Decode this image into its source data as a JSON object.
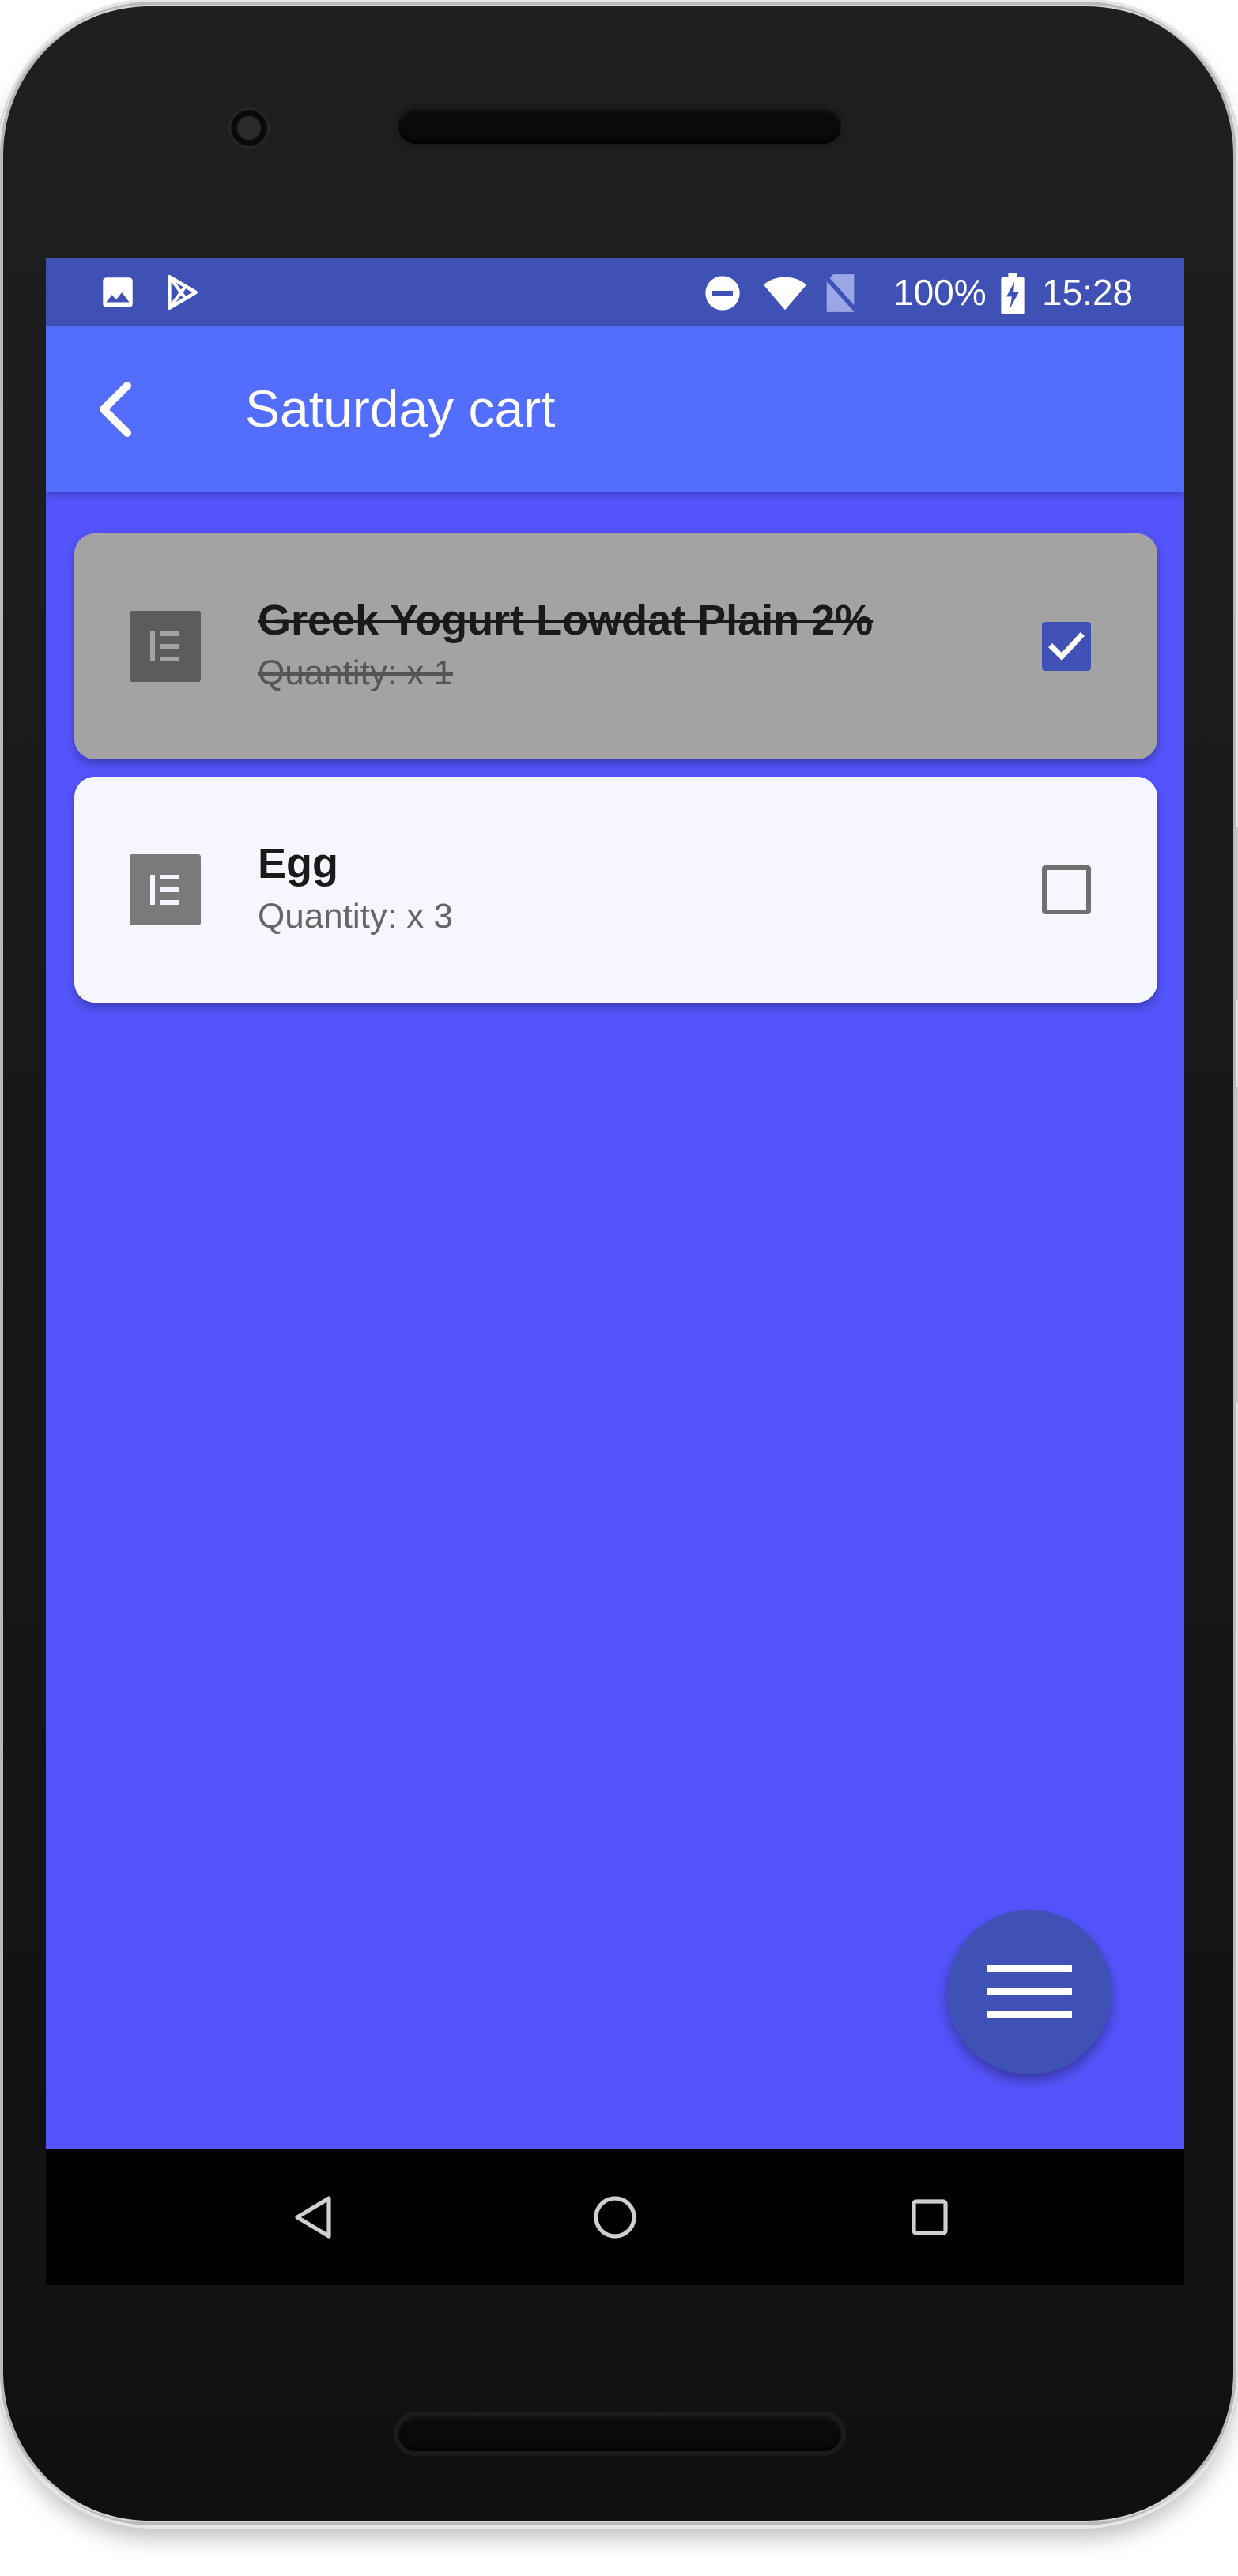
{
  "status_bar": {
    "battery": "100%",
    "time": "15:28",
    "left_icons": [
      "image-icon",
      "play-store-icon"
    ],
    "right_icons": [
      "do-not-disturb-icon",
      "wifi-icon",
      "no-sim-icon",
      "battery-charging-icon"
    ]
  },
  "app_bar": {
    "title": "Saturday cart",
    "back_icon": "arrow-back-icon"
  },
  "items": [
    {
      "name": "Greek Yogurt Lowdat Plain 2%",
      "quantity": "Quantity: x 1",
      "checked": true,
      "icon": "list-item-icon"
    },
    {
      "name": "Egg",
      "quantity": "Quantity: x 3",
      "checked": false,
      "icon": "list-item-icon"
    }
  ],
  "fab": {
    "icon": "menu-icon"
  },
  "nav": {
    "buttons": [
      "back-triangle-icon",
      "home-circle-icon",
      "recents-square-icon"
    ]
  },
  "colors": {
    "screen_background": "#5454fd",
    "status_bar": "#3f51b5",
    "app_bar": "#536dfe",
    "checked_card": "#a3a3a3",
    "unchecked_card": "#f6f7fe",
    "accent": "#3f51b5"
  }
}
